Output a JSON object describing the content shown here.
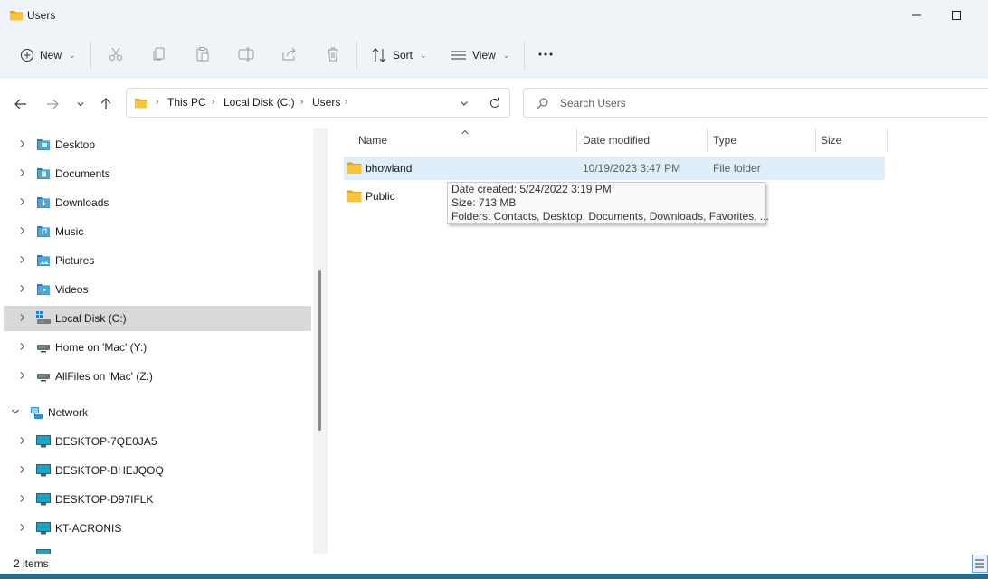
{
  "window": {
    "title": "Users",
    "minimize": "minimize",
    "maximize": "maximize"
  },
  "toolbar": {
    "new_label": "New",
    "sort_label": "Sort",
    "view_label": "View",
    "icons": [
      "plus-icon",
      "cut-icon",
      "copy-icon",
      "paste-icon",
      "rename-icon",
      "share-icon",
      "delete-icon",
      "sort-icon",
      "view-icon",
      "more-icon"
    ]
  },
  "address": {
    "crumbs": [
      "This PC",
      "Local Disk (C:)",
      "Users"
    ]
  },
  "search": {
    "placeholder": "Search Users"
  },
  "navpane": {
    "items": [
      {
        "label": "Desktop",
        "icon": "desktop-folder-icon"
      },
      {
        "label": "Documents",
        "icon": "documents-folder-icon"
      },
      {
        "label": "Downloads",
        "icon": "downloads-folder-icon"
      },
      {
        "label": "Music",
        "icon": "music-folder-icon"
      },
      {
        "label": "Pictures",
        "icon": "pictures-folder-icon"
      },
      {
        "label": "Videos",
        "icon": "videos-folder-icon"
      },
      {
        "label": "Local Disk (C:)",
        "icon": "drive-icon"
      },
      {
        "label": "Home on 'Mac' (Y:)",
        "icon": "network-drive-icon"
      },
      {
        "label": "AllFiles on 'Mac' (Z:)",
        "icon": "network-drive-icon"
      },
      {
        "label": "Network",
        "icon": "network-icon"
      },
      {
        "label": "DESKTOP-7QE0JA5",
        "icon": "computer-icon"
      },
      {
        "label": "DESKTOP-BHEJQOQ",
        "icon": "computer-icon"
      },
      {
        "label": "DESKTOP-D97IFLK",
        "icon": "computer-icon"
      },
      {
        "label": "KT-ACRONIS",
        "icon": "computer-icon"
      }
    ]
  },
  "columns": {
    "name": "Name",
    "date": "Date modified",
    "type": "Type",
    "size": "Size"
  },
  "files": [
    {
      "name": "bhowland",
      "date": "10/19/2023 3:47 PM",
      "type": "File folder",
      "size": ""
    },
    {
      "name": "Public",
      "date": "",
      "type": "",
      "size": ""
    }
  ],
  "tooltip": {
    "line1": "Date created: 5/24/2022 3:19 PM",
    "line2": "Size: 713 MB",
    "line3": "Folders: Contacts, Desktop, Documents, Downloads, Favorites, ..."
  },
  "status": {
    "count": "2 items"
  },
  "colors": {
    "folder": "#f5c242",
    "accent": "#0067c0",
    "hover": "#e0eef9"
  }
}
